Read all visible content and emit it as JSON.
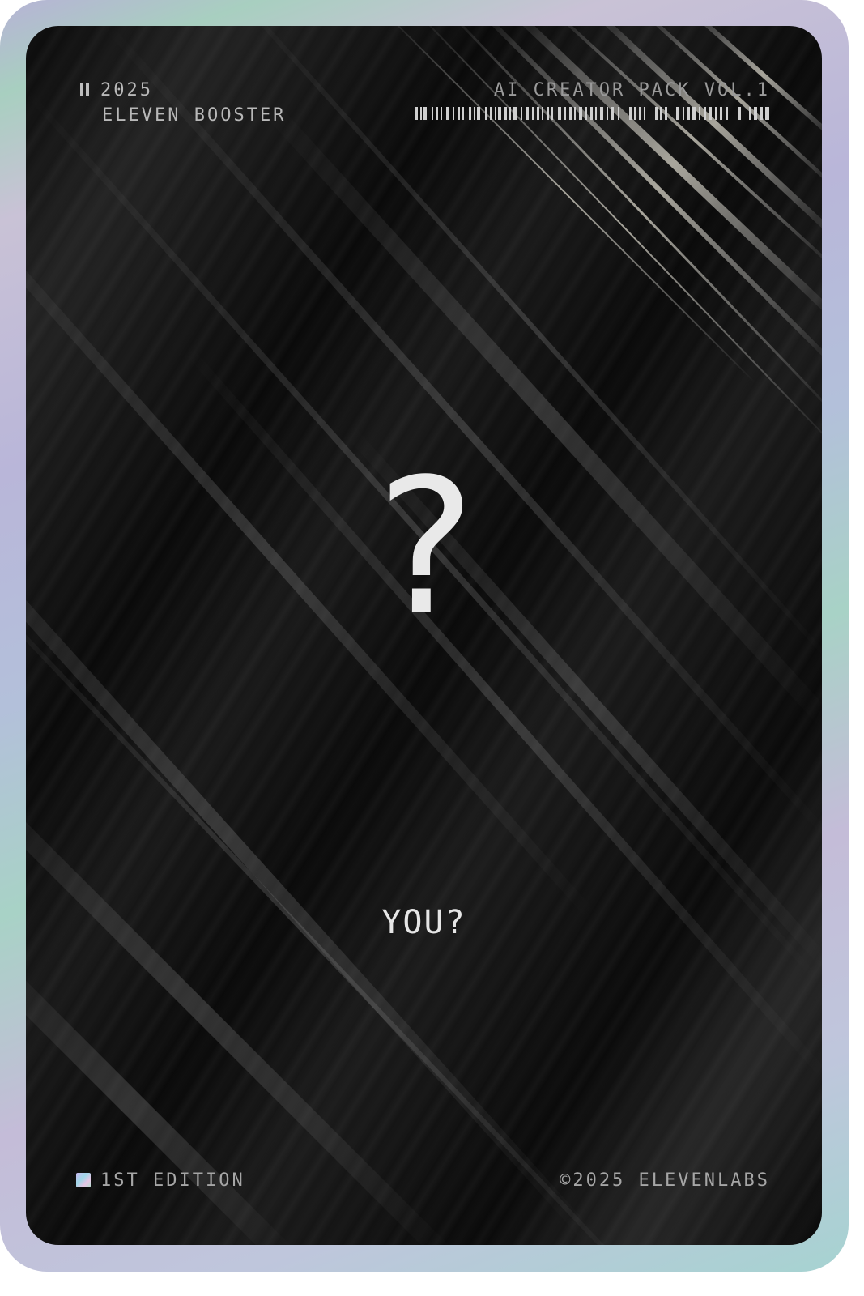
{
  "card": {
    "year": "2025",
    "series": "ELEVEN BOOSTER",
    "pack_name": "AI CREATOR PACK VOL.1",
    "mystery_symbol": "?",
    "caption": "YOU?",
    "edition": "1ST EDITION",
    "copyright": "©2025 ELEVENLABS"
  },
  "icons": {
    "top_left": "pause-icon",
    "edition": "holographic-square-icon",
    "barcode": "barcode-icon"
  },
  "colors": {
    "frame_holographic": "#b9b6d9",
    "card_background": "#0a0a0a",
    "text_primary": "#e9e9e9",
    "text_secondary": "#a6a6a6"
  }
}
